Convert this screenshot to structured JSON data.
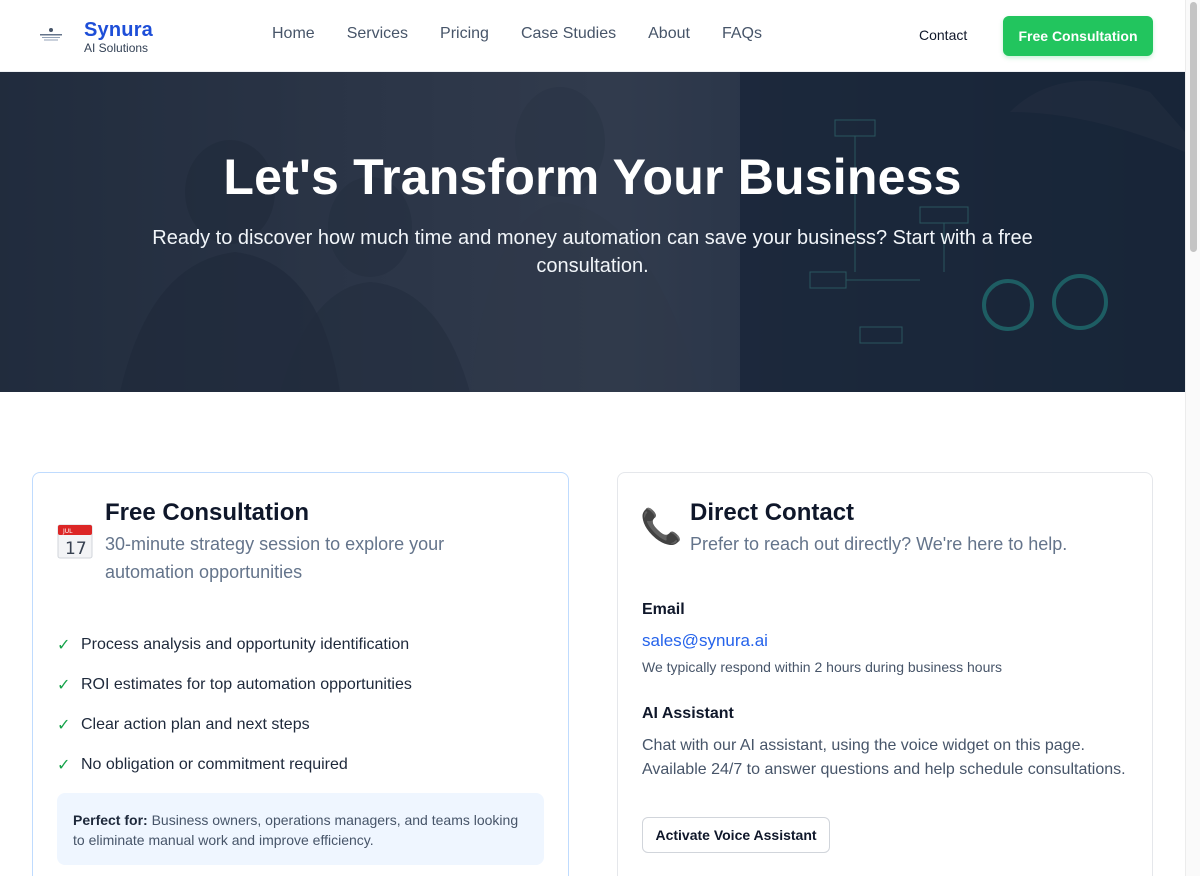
{
  "header": {
    "brand_name": "Synura",
    "brand_tagline": "AI Solutions",
    "nav": [
      "Home",
      "Services",
      "Pricing",
      "Case Studies",
      "About",
      "FAQs"
    ],
    "contact_label": "Contact",
    "cta_label": "Free Consultation",
    "accent_color": "#22c55e",
    "brand_color": "#1d4ed8"
  },
  "hero": {
    "title": "Let's Transform Your Business",
    "subtitle": "Ready to discover how much time and money automation can save your business? Start with a free consultation.",
    "background": "office-team-dashboard-photo"
  },
  "consultation": {
    "icon": "calendar-icon",
    "title": "Free Consultation",
    "subtitle": "30-minute strategy session to explore your automation opportunities",
    "features": [
      "Process analysis and opportunity identification",
      "ROI estimates for top automation opportunities",
      "Clear action plan and next steps",
      "No obligation or commitment required"
    ],
    "perfect_for_label": "Perfect for:",
    "perfect_for_text": "Business owners, operations managers, and teams looking to eliminate manual work and improve efficiency."
  },
  "direct_contact": {
    "icon": "phone-icon",
    "title": "Direct Contact",
    "subtitle": "Prefer to reach out directly? We're here to help.",
    "email_label": "Email",
    "email": "sales@synura.ai",
    "email_note": "We typically respond within 2 hours during business hours",
    "ai_label": "AI Assistant",
    "ai_text": "Chat with our AI assistant, using the voice widget on this page. Available 24/7 to answer questions and help schedule consultations.",
    "voice_button": "Activate Voice Assistant"
  }
}
